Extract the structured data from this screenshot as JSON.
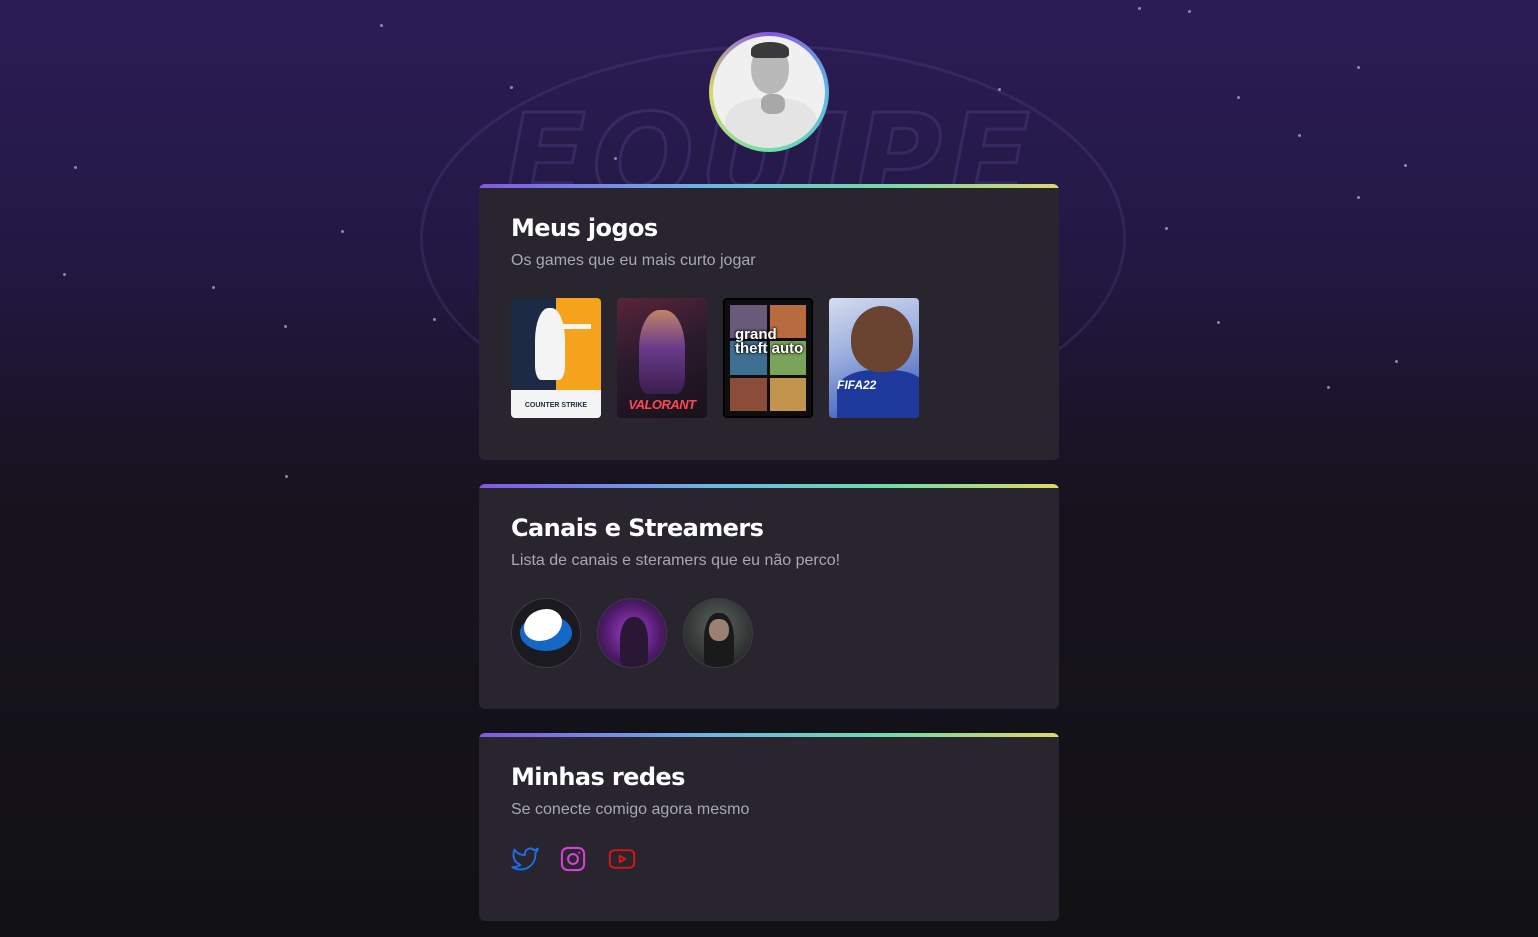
{
  "sections": {
    "games": {
      "title": "Meus jogos",
      "subtitle": "Os games que eu mais curto jogar",
      "items": [
        {
          "name": "counter-strike",
          "label": "COUNTER STRIKE"
        },
        {
          "name": "valorant",
          "label": "VALORANT"
        },
        {
          "name": "gta-v",
          "label": "grand theft auto"
        },
        {
          "name": "fifa-22",
          "label": "FIFA22"
        }
      ]
    },
    "channels": {
      "title": "Canais e Streamers",
      "subtitle": "Lista de canais e steramers que eu não perco!"
    },
    "socials": {
      "title": "Minhas redes",
      "subtitle": "Se conecte comigo agora mesmo",
      "items": [
        {
          "icon": "twitter-icon",
          "color": "#1d6ff2"
        },
        {
          "icon": "instagram-icon",
          "color": "#d63fd1"
        },
        {
          "icon": "youtube-icon",
          "color": "#e01414"
        }
      ]
    }
  },
  "colors": {
    "accent_gradient": [
      "#8257e5",
      "#6bb7e6",
      "#6fdca8",
      "#e0d767"
    ],
    "card_bg": "#29252f",
    "page_bg": "#121214"
  }
}
